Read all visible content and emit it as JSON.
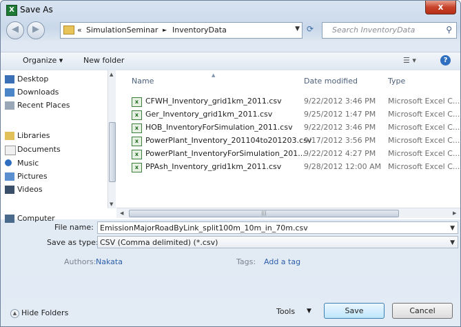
{
  "window": {
    "title": "Save As",
    "close_label": "x"
  },
  "address_bar": {
    "prefix": "«",
    "crumbs": [
      "SimulationSeminar",
      "InventoryData"
    ],
    "separator": "►"
  },
  "search": {
    "placeholder": "Search InventoryData"
  },
  "toolbar": {
    "organize": "Organize ▾",
    "new_folder": "New folder",
    "view": "☰ ▾"
  },
  "nav_pane": {
    "items": [
      {
        "label": "Desktop",
        "icon": "desktop-icon"
      },
      {
        "label": "Downloads",
        "icon": "downloads-icon"
      },
      {
        "label": "Recent Places",
        "icon": "recent-places-icon"
      },
      {
        "label": "Libraries",
        "icon": "libraries-icon"
      },
      {
        "label": "Documents",
        "icon": "documents-icon"
      },
      {
        "label": "Music",
        "icon": "music-icon"
      },
      {
        "label": "Pictures",
        "icon": "pictures-icon"
      },
      {
        "label": "Videos",
        "icon": "videos-icon"
      },
      {
        "label": "Computer",
        "icon": "computer-icon"
      }
    ]
  },
  "file_list": {
    "columns": {
      "name": "Name",
      "date": "Date modified",
      "type": "Type"
    },
    "rows": [
      {
        "name": "CFWH_Inventory_grid1km_2011.csv",
        "date": "9/22/2012 3:46 PM",
        "type": "Microsoft Excel C..."
      },
      {
        "name": "Ger_Inventory_grid1km_2011.csv",
        "date": "9/25/2012 1:47 PM",
        "type": "Microsoft Excel C..."
      },
      {
        "name": "HOB_InventoryForSimulation_2011.csv",
        "date": "9/22/2012 3:46 PM",
        "type": "Microsoft Excel C..."
      },
      {
        "name": "PowerPlant_Inventory_201104to201203.csv",
        "date": "9/17/2012 3:56 PM",
        "type": "Microsoft Excel C..."
      },
      {
        "name": "PowerPlant_InventoryForSimulation_201...",
        "date": "9/22/2012 4:27 PM",
        "type": "Microsoft Excel C..."
      },
      {
        "name": "PPAsh_Inventory_grid1km_2011.csv",
        "date": "9/28/2012 12:00 AM",
        "type": "Microsoft Excel C..."
      }
    ]
  },
  "form": {
    "file_name_label": "File name:",
    "file_name_value": "EmissionMajorRoadByLink_split100m_10m_in_70m.csv",
    "save_type_label": "Save as type:",
    "save_type_value": "CSV (Comma delimited) (*.csv)",
    "authors_label": "Authors:",
    "authors_value": "Nakata",
    "tags_label": "Tags:",
    "tags_value": "Add a tag"
  },
  "footer": {
    "hide_folders": "Hide Folders",
    "tools": "Tools",
    "save": "Save",
    "cancel": "Cancel"
  }
}
